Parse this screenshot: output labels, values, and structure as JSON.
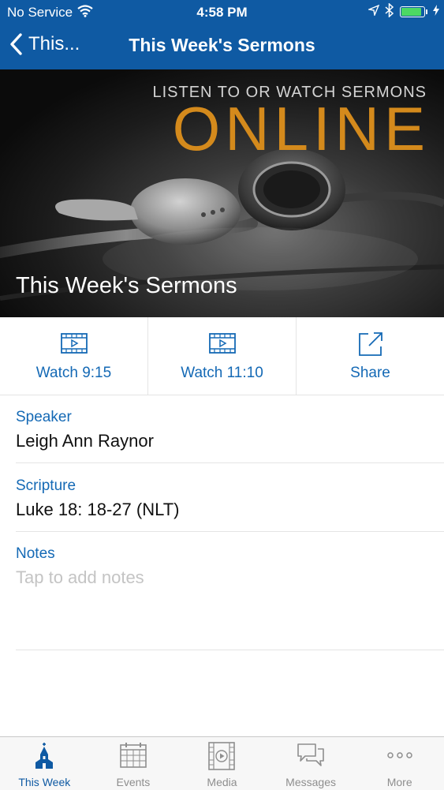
{
  "status_bar": {
    "carrier": "No Service",
    "time": "4:58 PM",
    "battery_level": 0.9,
    "battery_color": "#4cd964"
  },
  "nav": {
    "back_label": "This...",
    "title": "This Week's Sermons",
    "bar_color": "#0f5aa3"
  },
  "hero": {
    "top_line": "LISTEN TO OR WATCH SERMONS",
    "big_word": "ONLINE",
    "title": "This Week's Sermons",
    "accent_color": "#d48a1c",
    "image": "earbuds-photo"
  },
  "actions": [
    {
      "icon": "video-icon",
      "label": "Watch 9:15"
    },
    {
      "icon": "video-icon",
      "label": "Watch 11:10"
    },
    {
      "icon": "share-icon",
      "label": "Share"
    }
  ],
  "details": {
    "speaker_label": "Speaker",
    "speaker_value": "Leigh Ann Raynor",
    "scripture_label": "Scripture",
    "scripture_value": "Luke 18: 18-27 (NLT)",
    "notes_label": "Notes",
    "notes_placeholder": "Tap to add notes"
  },
  "tabs": [
    {
      "icon": "church-icon",
      "label": "This Week",
      "active": true
    },
    {
      "icon": "calendar-icon",
      "label": "Events",
      "active": false
    },
    {
      "icon": "media-icon",
      "label": "Media",
      "active": false
    },
    {
      "icon": "messages-icon",
      "label": "Messages",
      "active": false
    },
    {
      "icon": "more-icon",
      "label": "More",
      "active": false
    }
  ],
  "colors": {
    "link_blue": "#1469b5",
    "tab_active": "#0f5aa3",
    "tab_inactive": "#8e8e8e"
  }
}
